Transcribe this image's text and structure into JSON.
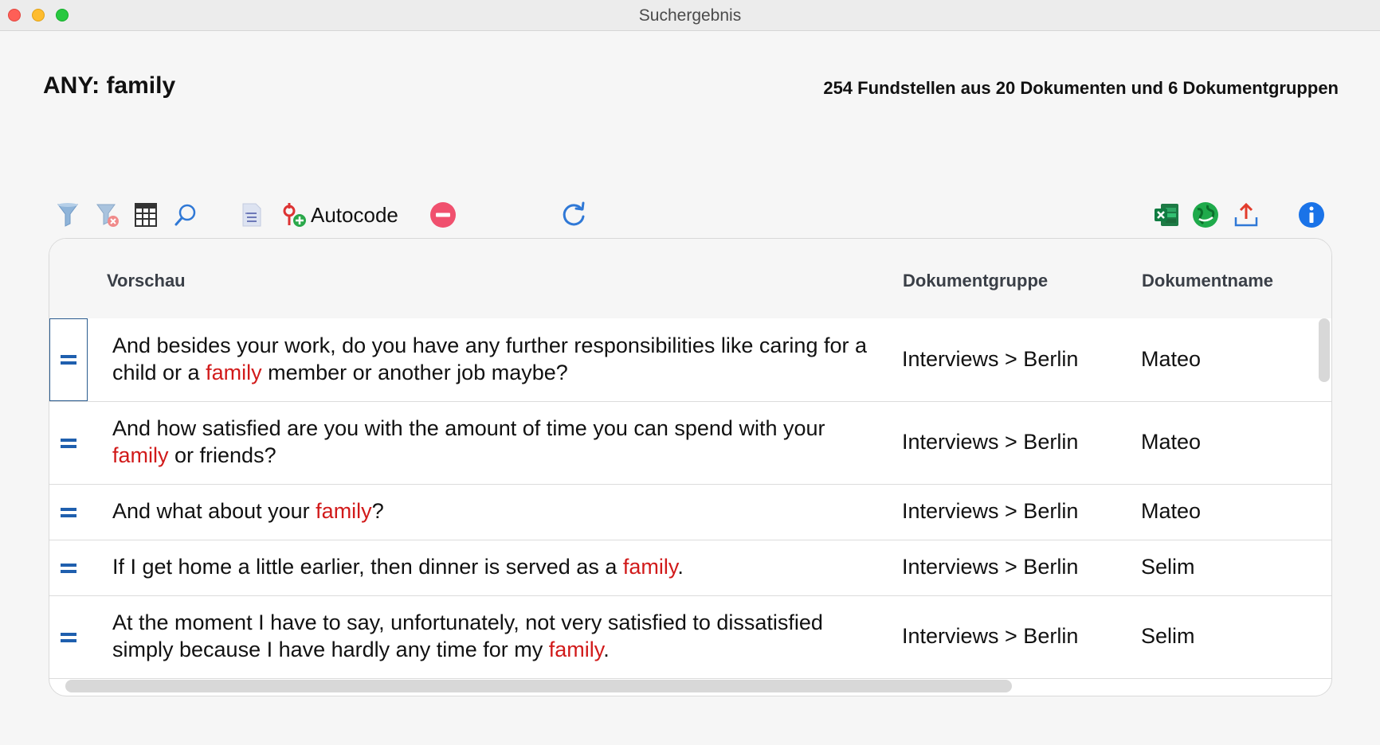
{
  "window": {
    "title": "Suchergebnis"
  },
  "header": {
    "query": "ANY: family",
    "summary": "254 Fundstellen aus 20 Dokumenten und 6 Dokumentgruppen"
  },
  "toolbar": {
    "left_icons": [
      "filter-icon",
      "clear-filter-icon",
      "columns-icon",
      "search-icon",
      "document-list-icon"
    ],
    "autocode_label": "Autocode",
    "middle_icons": [
      "remove-icon",
      "refresh-icon"
    ],
    "right_icons": [
      "excel-export-icon",
      "web-export-icon",
      "upload-export-icon",
      "info-icon"
    ]
  },
  "table": {
    "columns": [
      "Vorschau",
      "Dokumentgruppe",
      "Dokumentname"
    ],
    "rows": [
      {
        "preview_before": "And besides your work, do you have any further responsibilities like caring for a child or a ",
        "highlight": "family",
        "preview_after": " member or another job maybe?",
        "group": "Interviews > Berlin",
        "document": "Mateo"
      },
      {
        "preview_before": "And how satisfied are you with the amount of time you can spend with your ",
        "highlight": "family",
        "preview_after": " or friends?",
        "group": "Interviews > Berlin",
        "document": "Mateo"
      },
      {
        "preview_before": "And what about your ",
        "highlight": "family",
        "preview_after": "?",
        "group": "Interviews > Berlin",
        "document": "Mateo"
      },
      {
        "preview_before": "If I get home a little earlier, then dinner is served as a ",
        "highlight": "family",
        "preview_after": ".",
        "group": "Interviews > Berlin",
        "document": "Selim"
      },
      {
        "preview_before": "At the moment I have to say, unfortunately, not very satisfied to dissatisfied simply because I have hardly any time for my ",
        "highlight": "family",
        "preview_after": ".",
        "group": "Interviews > Berlin",
        "document": "Selim"
      }
    ]
  },
  "colors": {
    "highlight": "#d11a1a",
    "marker": "#1f5fae",
    "accent_blue": "#1a73e8"
  }
}
